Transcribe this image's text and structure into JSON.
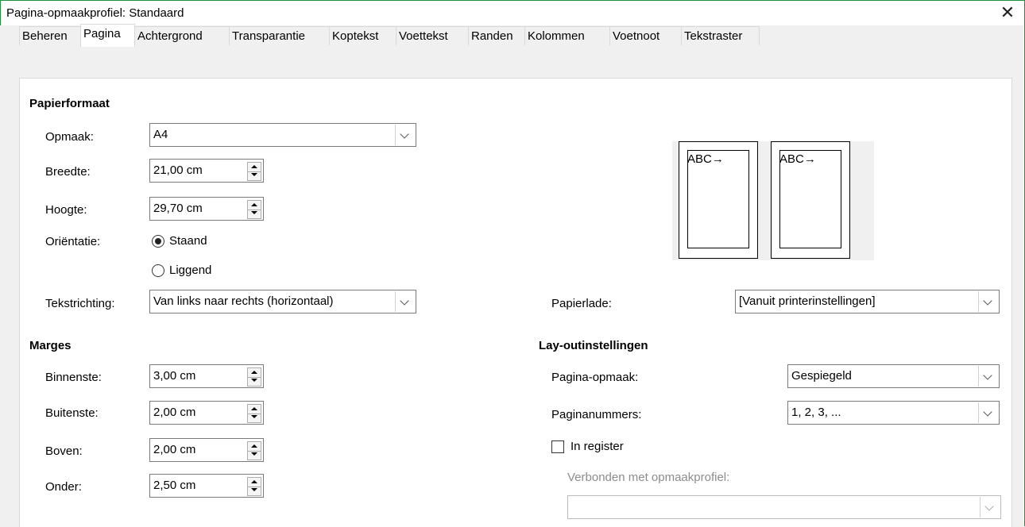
{
  "window": {
    "title": "Pagina-opmaakprofiel: Standaard",
    "close_glyph": "✕"
  },
  "tabs": [
    "Beheren",
    "Pagina",
    "Achtergrond",
    "Transparantie",
    "Koptekst",
    "Voettekst",
    "Randen",
    "Kolommen",
    "Voetnoot",
    "Tekstraster"
  ],
  "active_tab": "Pagina",
  "paper": {
    "header": "Papierformaat",
    "format_label": "Opmaak:",
    "format_value": "A4",
    "width_label": "Breedte:",
    "width_value": "21,00 cm",
    "height_label": "Hoogte:",
    "height_value": "29,70 cm",
    "orientation_label": "Oriëntatie:",
    "portrait_label": "Staand",
    "landscape_label": "Liggend",
    "orientation_selected": "Staand",
    "direction_label": "Tekstrichting:",
    "direction_value": "Van links naar rechts (horizontaal)",
    "tray_label": "Papierlade:",
    "tray_value": "[Vanuit printerinstellingen]"
  },
  "preview": {
    "left_text": "ABC→",
    "right_text": "ABC→"
  },
  "margins": {
    "header": "Marges",
    "inner_label": "Binnenste:",
    "inner_value": "3,00 cm",
    "outer_label": "Buitenste:",
    "outer_value": "2,00 cm",
    "top_label": "Boven:",
    "top_value": "2,00 cm",
    "bottom_label": "Onder:",
    "bottom_value": "2,50 cm"
  },
  "layout": {
    "header": "Lay-outinstellingen",
    "page_layout_label": "Pagina-opmaak:",
    "page_layout_value": "Gespiegeld",
    "page_numbers_label": "Paginanummers:",
    "page_numbers_value": "1, 2, 3, ...",
    "register_label": "In register",
    "register_checked": false,
    "ref_style_label": "Verbonden met opmaakprofiel:",
    "ref_style_value": ""
  },
  "colors": {
    "frame_border": "#1e8f3a",
    "disabled_text": "#8c8c8c"
  }
}
